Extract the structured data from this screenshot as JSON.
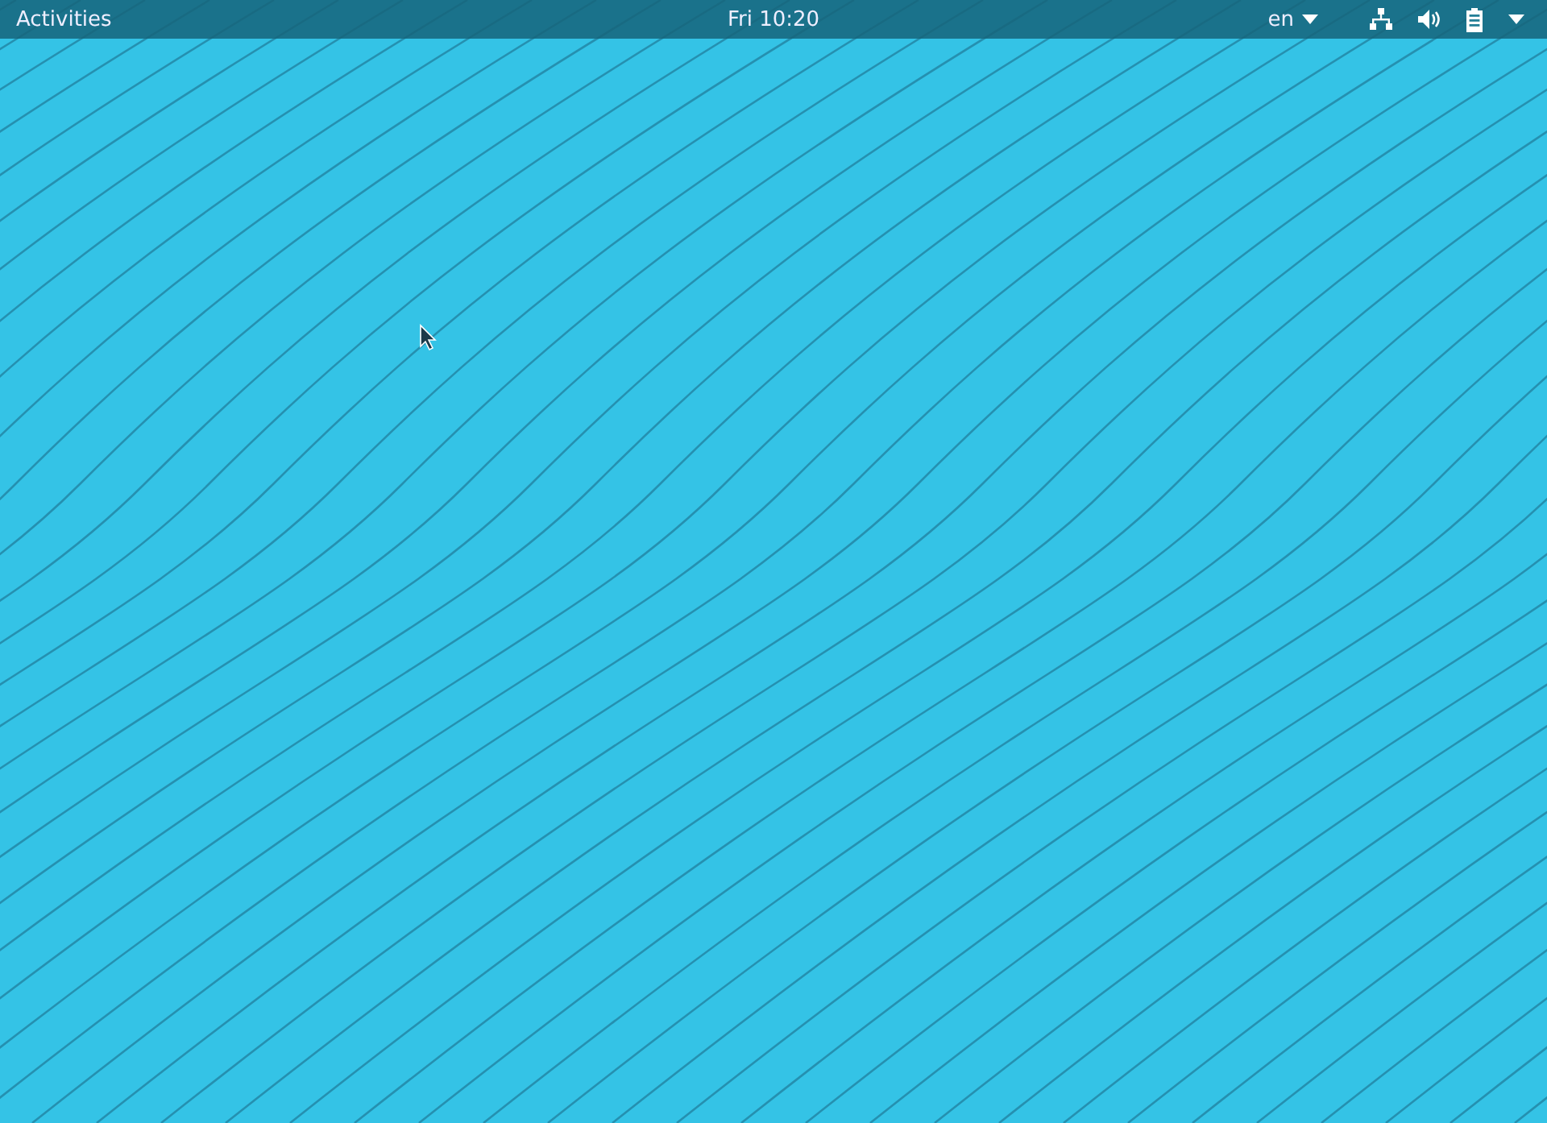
{
  "top_bar": {
    "activities": "Activities",
    "clock": "Fri 10:20",
    "language": "en"
  }
}
